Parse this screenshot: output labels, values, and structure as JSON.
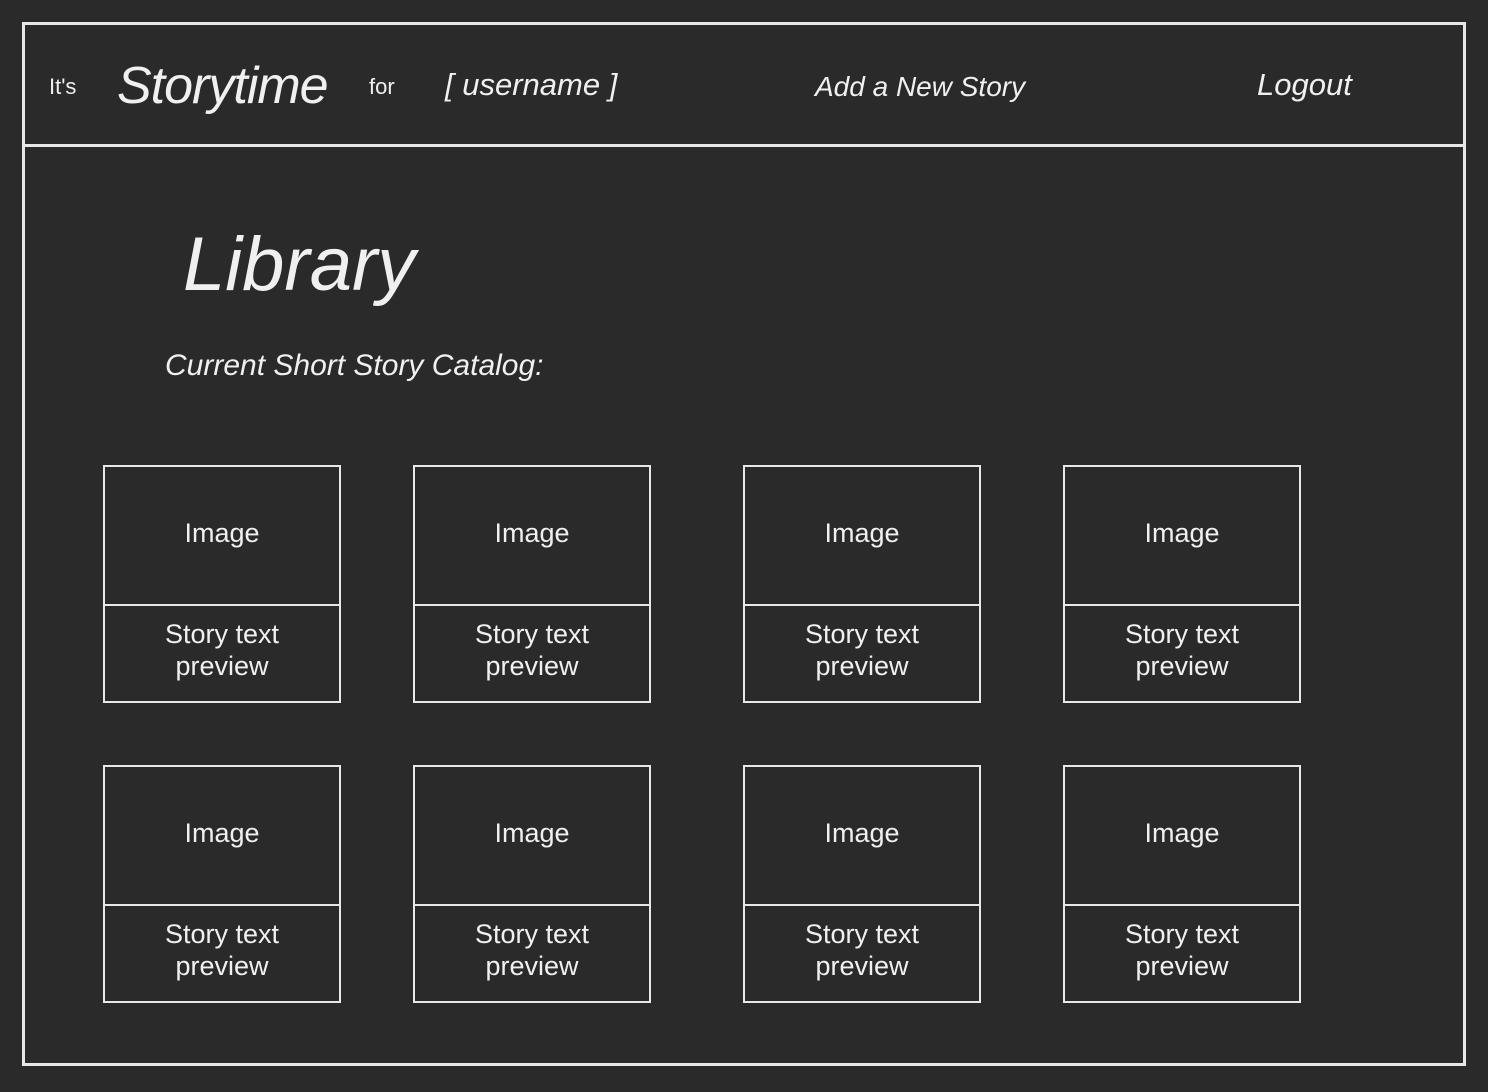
{
  "header": {
    "its": "It's",
    "brand": "Storytime",
    "for": "for",
    "username": "[ username ]",
    "add_story": "Add a New Story",
    "logout": "Logout"
  },
  "main": {
    "title": "Library",
    "subtitle": "Current Short Story Catalog:"
  },
  "stories": [
    {
      "image": "Image",
      "preview": "Story text preview"
    },
    {
      "image": "Image",
      "preview": "Story text preview"
    },
    {
      "image": "Image",
      "preview": "Story text preview"
    },
    {
      "image": "Image",
      "preview": "Story text preview"
    },
    {
      "image": "Image",
      "preview": "Story text preview"
    },
    {
      "image": "Image",
      "preview": "Story text preview"
    },
    {
      "image": "Image",
      "preview": "Story text preview"
    },
    {
      "image": "Image",
      "preview": "Story text preview"
    }
  ],
  "colors": {
    "background": "#2a2a2a",
    "foreground": "#f0f0f0",
    "border": "#e8e8e8"
  }
}
